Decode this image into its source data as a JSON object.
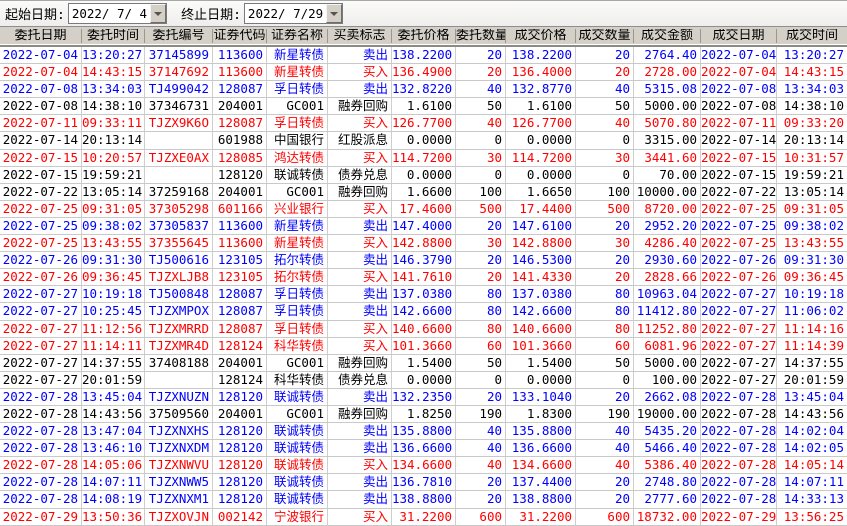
{
  "toolbar": {
    "start_date_label": "起始日期:",
    "start_date_value": "2022/ 7/ 4",
    "end_date_label": "终止日期:",
    "end_date_value": "2022/ 7/29"
  },
  "colors": {
    "buy": "#ff0000",
    "sell": "#0000ff",
    "neutral": "#000000",
    "header_bg": "#d4d0c8"
  },
  "table": {
    "columns": [
      "委托日期",
      "委托时间",
      "委托编号",
      "证券代码",
      "证券名称",
      "买卖标志",
      "委托价格",
      "委托数量",
      "成交价格",
      "成交数量",
      "成交金额",
      "成交日期",
      "成交时间"
    ],
    "rows": [
      {
        "tone": "sell",
        "cells": [
          "2022-07-04",
          "13:20:27",
          "37145899",
          "113600",
          "新星转债",
          "卖出",
          "138.2200",
          "20",
          "138.2200",
          "20",
          "2764.40",
          "2022-07-04",
          "13:20:27"
        ]
      },
      {
        "tone": "buy",
        "cells": [
          "2022-07-04",
          "14:43:15",
          "37147692",
          "113600",
          "新星转债",
          "买入",
          "136.4900",
          "20",
          "136.4000",
          "20",
          "2728.00",
          "2022-07-04",
          "14:43:15"
        ]
      },
      {
        "tone": "sell",
        "cells": [
          "2022-07-08",
          "13:34:03",
          "TJ499042",
          "128087",
          "孚日转债",
          "卖出",
          "132.8220",
          "40",
          "132.8770",
          "40",
          "5315.08",
          "2022-07-08",
          "13:34:03"
        ]
      },
      {
        "tone": "neutral",
        "cells": [
          "2022-07-08",
          "14:38:10",
          "37346731",
          "204001",
          "GC001",
          "融券回购",
          "1.6100",
          "50",
          "1.6100",
          "50",
          "5000.00",
          "2022-07-08",
          "14:38:10"
        ]
      },
      {
        "tone": "buy",
        "cells": [
          "2022-07-11",
          "09:33:11",
          "TJZX9K6O",
          "128087",
          "孚日转债",
          "买入",
          "126.7700",
          "40",
          "126.7700",
          "40",
          "5070.80",
          "2022-07-11",
          "09:33:20"
        ]
      },
      {
        "tone": "neutral",
        "cells": [
          "2022-07-14",
          "20:13:14",
          "",
          "601988",
          "中国银行",
          "红股派息",
          "0.0000",
          "0",
          "0.0000",
          "0",
          "3315.00",
          "2022-07-14",
          "20:13:14"
        ]
      },
      {
        "tone": "buy",
        "cells": [
          "2022-07-15",
          "10:20:57",
          "TJZXE0AX",
          "128085",
          "鸿达转债",
          "买入",
          "114.7200",
          "30",
          "114.7200",
          "30",
          "3441.60",
          "2022-07-15",
          "10:31:57"
        ]
      },
      {
        "tone": "neutral",
        "cells": [
          "2022-07-15",
          "19:59:21",
          "",
          "128120",
          "联诚转债",
          "债券兑息",
          "0.0000",
          "0",
          "0.0000",
          "0",
          "70.00",
          "2022-07-15",
          "19:59:21"
        ]
      },
      {
        "tone": "neutral",
        "cells": [
          "2022-07-22",
          "13:05:14",
          "37259168",
          "204001",
          "GC001",
          "融券回购",
          "1.6600",
          "100",
          "1.6650",
          "100",
          "10000.00",
          "2022-07-22",
          "13:05:14"
        ]
      },
      {
        "tone": "buy",
        "cells": [
          "2022-07-25",
          "09:31:05",
          "37305298",
          "601166",
          "兴业银行",
          "买入",
          "17.4600",
          "500",
          "17.4400",
          "500",
          "8720.00",
          "2022-07-25",
          "09:31:05"
        ]
      },
      {
        "tone": "sell",
        "cells": [
          "2022-07-25",
          "09:38:02",
          "37305837",
          "113600",
          "新星转债",
          "卖出",
          "147.4000",
          "20",
          "147.6100",
          "20",
          "2952.20",
          "2022-07-25",
          "09:38:02"
        ]
      },
      {
        "tone": "buy",
        "cells": [
          "2022-07-25",
          "13:43:55",
          "37355645",
          "113600",
          "新星转债",
          "买入",
          "142.8800",
          "30",
          "142.8800",
          "30",
          "4286.40",
          "2022-07-25",
          "13:43:55"
        ]
      },
      {
        "tone": "sell",
        "cells": [
          "2022-07-26",
          "09:31:30",
          "TJ500616",
          "123105",
          "拓尔转债",
          "卖出",
          "146.3790",
          "20",
          "146.5300",
          "20",
          "2930.60",
          "2022-07-26",
          "09:31:30"
        ]
      },
      {
        "tone": "buy",
        "cells": [
          "2022-07-26",
          "09:36:45",
          "TJZXLJB8",
          "123105",
          "拓尔转债",
          "买入",
          "141.7610",
          "20",
          "141.4330",
          "20",
          "2828.66",
          "2022-07-26",
          "09:36:45"
        ]
      },
      {
        "tone": "sell",
        "cells": [
          "2022-07-27",
          "10:19:18",
          "TJ500848",
          "128087",
          "孚日转债",
          "卖出",
          "137.0380",
          "80",
          "137.0380",
          "80",
          "10963.04",
          "2022-07-27",
          "10:19:18"
        ]
      },
      {
        "tone": "sell",
        "cells": [
          "2022-07-27",
          "10:25:45",
          "TJZXMPOX",
          "128087",
          "孚日转债",
          "卖出",
          "142.6600",
          "80",
          "142.6600",
          "80",
          "11412.80",
          "2022-07-27",
          "11:06:02"
        ]
      },
      {
        "tone": "buy",
        "cells": [
          "2022-07-27",
          "11:12:56",
          "TJZXMRRD",
          "128087",
          "孚日转债",
          "买入",
          "140.6600",
          "80",
          "140.6600",
          "80",
          "11252.80",
          "2022-07-27",
          "11:14:16"
        ]
      },
      {
        "tone": "buy",
        "cells": [
          "2022-07-27",
          "11:14:11",
          "TJZXMR4D",
          "128124",
          "科华转债",
          "买入",
          "101.3660",
          "60",
          "101.3660",
          "60",
          "6081.96",
          "2022-07-27",
          "11:14:39"
        ]
      },
      {
        "tone": "neutral",
        "cells": [
          "2022-07-27",
          "14:37:55",
          "37408188",
          "204001",
          "GC001",
          "融券回购",
          "1.5400",
          "50",
          "1.5400",
          "50",
          "5000.00",
          "2022-07-27",
          "14:37:55"
        ]
      },
      {
        "tone": "neutral",
        "cells": [
          "2022-07-27",
          "20:01:59",
          "",
          "128124",
          "科华转债",
          "债券兑息",
          "0.0000",
          "0",
          "0.0000",
          "0",
          "100.00",
          "2022-07-27",
          "20:01:59"
        ]
      },
      {
        "tone": "sell",
        "cells": [
          "2022-07-28",
          "13:45:04",
          "TJZXNUZN",
          "128120",
          "联诚转债",
          "卖出",
          "132.2350",
          "20",
          "133.1040",
          "20",
          "2662.08",
          "2022-07-28",
          "13:45:04"
        ]
      },
      {
        "tone": "neutral",
        "cells": [
          "2022-07-28",
          "14:43:56",
          "37509560",
          "204001",
          "GC001",
          "融券回购",
          "1.8250",
          "190",
          "1.8300",
          "190",
          "19000.00",
          "2022-07-28",
          "14:43:56"
        ]
      },
      {
        "tone": "sell",
        "cells": [
          "2022-07-28",
          "13:47:04",
          "TJZXNXHS",
          "128120",
          "联诚转债",
          "卖出",
          "135.8800",
          "40",
          "135.8800",
          "40",
          "5435.20",
          "2022-07-28",
          "14:02:04"
        ]
      },
      {
        "tone": "sell",
        "cells": [
          "2022-07-28",
          "13:46:10",
          "TJZXNXDM",
          "128120",
          "联诚转债",
          "卖出",
          "136.6600",
          "40",
          "136.6600",
          "40",
          "5466.40",
          "2022-07-28",
          "14:02:05"
        ]
      },
      {
        "tone": "buy",
        "cells": [
          "2022-07-28",
          "14:05:06",
          "TJZXNWVU",
          "128120",
          "联诚转债",
          "买入",
          "134.6600",
          "40",
          "134.6600",
          "40",
          "5386.40",
          "2022-07-28",
          "14:05:14"
        ]
      },
      {
        "tone": "sell",
        "cells": [
          "2022-07-28",
          "14:07:11",
          "TJZXNWW5",
          "128120",
          "联诚转债",
          "卖出",
          "136.7810",
          "20",
          "137.4400",
          "20",
          "2748.80",
          "2022-07-28",
          "14:07:11"
        ]
      },
      {
        "tone": "sell",
        "cells": [
          "2022-07-28",
          "14:08:19",
          "TJZXNXM1",
          "128120",
          "联诚转债",
          "卖出",
          "138.8800",
          "20",
          "138.8800",
          "20",
          "2777.60",
          "2022-07-28",
          "14:33:13"
        ]
      },
      {
        "tone": "buy",
        "cells": [
          "2022-07-29",
          "13:50:36",
          "TJZXOVJN",
          "002142",
          "宁波银行",
          "买入",
          "31.2200",
          "600",
          "31.2200",
          "600",
          "18732.00",
          "2022-07-29",
          "13:56:25"
        ]
      }
    ]
  }
}
